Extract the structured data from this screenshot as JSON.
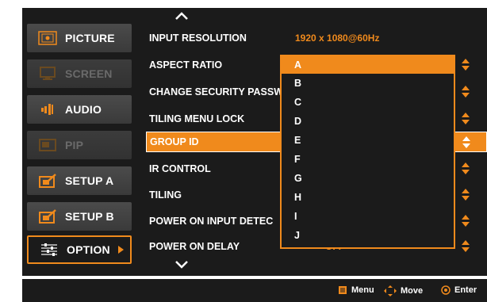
{
  "sidebar": {
    "items": [
      {
        "label": "PICTURE",
        "icon": "picture-icon",
        "state": "normal"
      },
      {
        "label": "SCREEN",
        "icon": "screen-icon",
        "state": "disabled"
      },
      {
        "label": "AUDIO",
        "icon": "audio-icon",
        "state": "normal"
      },
      {
        "label": "PIP",
        "icon": "pip-icon",
        "state": "disabled"
      },
      {
        "label": "SETUP A",
        "icon": "setup-a-icon",
        "state": "normal"
      },
      {
        "label": "SETUP B",
        "icon": "setup-b-icon",
        "state": "normal"
      },
      {
        "label": "OPTION",
        "icon": "option-icon",
        "state": "active"
      }
    ]
  },
  "menu": {
    "rows": [
      {
        "label": "INPUT RESOLUTION",
        "value": "1920 x 1080@60Hz"
      },
      {
        "label": "ASPECT RATIO",
        "value": ""
      },
      {
        "label": "CHANGE SECURITY PASSW",
        "value": ""
      },
      {
        "label": "TILING MENU LOCK",
        "value": ""
      },
      {
        "label": "GROUP ID",
        "value": ""
      },
      {
        "label": "IR CONTROL",
        "value": ""
      },
      {
        "label": "TILING",
        "value": ""
      },
      {
        "label": "POWER ON INPUT DETEC",
        "value": ""
      },
      {
        "label": "POWER ON DELAY",
        "value": "OFF"
      }
    ],
    "selected_row": "GROUP ID"
  },
  "dropdown": {
    "options": [
      "A",
      "B",
      "C",
      "D",
      "E",
      "F",
      "G",
      "H",
      "I",
      "J"
    ],
    "selected": "A"
  },
  "footer": {
    "menu_label": "Menu",
    "move_label": "Move",
    "enter_label": "Enter"
  },
  "colors": {
    "accent": "#f08a1c",
    "background": "#1b1b1b",
    "text": "#ffffff",
    "disabled_text": "#6a6a6a"
  }
}
